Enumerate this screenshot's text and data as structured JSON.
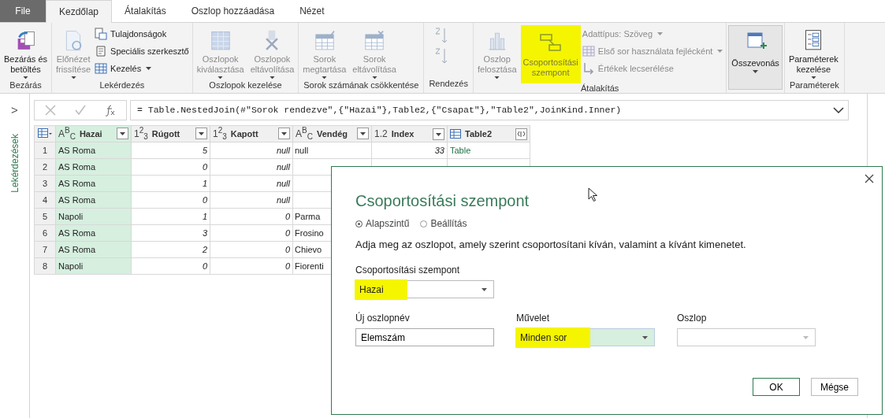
{
  "ribbon_tabs": [
    {
      "label": "File",
      "kind": "file",
      "selected": false
    },
    {
      "label": "Kezdőlap",
      "kind": "tab",
      "selected": true
    },
    {
      "label": "Átalakítás",
      "kind": "tab",
      "selected": false
    },
    {
      "label": "Oszlop hozzáadása",
      "kind": "tab",
      "selected": false
    },
    {
      "label": "Nézet",
      "kind": "tab",
      "selected": false
    }
  ],
  "ribbon_groups": [
    {
      "label": "Bezárás",
      "items": [
        {
          "kind": "large",
          "label": "Bezárás és\nbetöltés",
          "dropdown": true,
          "disabled": false
        }
      ]
    },
    {
      "label": "Lekérdezés",
      "items": [
        {
          "kind": "large",
          "label": "Előnézet\nfrissítése",
          "dropdown": true,
          "disabled": true
        },
        {
          "kind": "stack",
          "items": [
            {
              "label": "Tulajdonságok",
              "dropdown": false,
              "disabled": false
            },
            {
              "label": "Speciális szerkesztő",
              "dropdown": false,
              "disabled": false
            },
            {
              "label": "Kezelés",
              "dropdown": true,
              "disabled": false
            }
          ]
        }
      ]
    },
    {
      "label": "Oszlopok kezelése",
      "items": [
        {
          "kind": "large",
          "label": "Oszlopok\nkiválasztása",
          "dropdown": true,
          "disabled": true
        },
        {
          "kind": "large",
          "label": "Oszlopok\neltávolítása",
          "dropdown": true,
          "disabled": true
        }
      ]
    },
    {
      "label": "Sorok számának csökkentése",
      "items": [
        {
          "kind": "large",
          "label": "Sorok\nmegtartása",
          "dropdown": true,
          "disabled": true
        },
        {
          "kind": "large",
          "label": "Sorok\neltávolítása",
          "dropdown": true,
          "disabled": true
        }
      ]
    },
    {
      "label": "Rendezés",
      "items": [
        {
          "kind": "sort"
        }
      ]
    },
    {
      "label": "Átalakítás",
      "items": [
        {
          "kind": "large",
          "label": "Oszlop\nfelosztása",
          "dropdown": true,
          "disabled": true
        },
        {
          "kind": "large",
          "label": "Csoportosítási\nszempont",
          "dropdown": false,
          "disabled": true,
          "highlighted": true
        },
        {
          "kind": "stack",
          "items": [
            {
              "label": "Adattípus: Szöveg",
              "dropdown": true,
              "disabled": true
            },
            {
              "label": "Első sor használata fejlécként",
              "dropdown": true,
              "disabled": true
            },
            {
              "label": "Értékek lecserélése",
              "dropdown": false,
              "disabled": true
            }
          ]
        }
      ]
    },
    {
      "items": [
        {
          "kind": "large",
          "label": "Összevonás",
          "dropdown": true,
          "disabled": false,
          "pressed": true
        }
      ]
    },
    {
      "label": "Paraméterek",
      "items": [
        {
          "kind": "large",
          "label": "Paraméterek\nkezelése",
          "dropdown": true,
          "disabled": false
        }
      ]
    }
  ],
  "sidebar": {
    "title": "Lekérdezések",
    "expand": ">"
  },
  "formula_bar": {
    "formula": "= Table.NestedJoin(#\"Sorok rendezve\",{\"Hazai\"},Table2,{\"Csapat\"},\"Table2\",JoinKind.Inner)"
  },
  "table": {
    "columns": [
      {
        "type_label": "A$^{B}$$_{C}$",
        "name": "Hazai",
        "kind": "text",
        "selected": true
      },
      {
        "type_label": "1$^{2}$$_{3}$",
        "name": "Rúgott",
        "kind": "number",
        "selected": false
      },
      {
        "type_label": "1$^{2}$$_{3}$",
        "name": "Kapott",
        "kind": "number",
        "selected": false
      },
      {
        "type_label": "A$^{B}$$_{C}$",
        "name": "Vendég",
        "kind": "any",
        "selected": false
      },
      {
        "type_label": "1.2",
        "name": "Index",
        "kind": "number",
        "selected": false
      },
      {
        "name": "Table2",
        "kind": "table",
        "selected": false
      }
    ],
    "rows": [
      {
        "index": "1",
        "cells": [
          "AS Roma",
          "5",
          "null",
          "null",
          "33",
          "Table"
        ]
      },
      {
        "index": "2",
        "cells": [
          "AS Roma",
          "0",
          "null",
          "",
          "",
          ""
        ]
      },
      {
        "index": "3",
        "cells": [
          "AS Roma",
          "1",
          "null",
          "",
          "",
          ""
        ]
      },
      {
        "index": "4",
        "cells": [
          "AS Roma",
          "0",
          "null",
          "",
          "",
          ""
        ]
      },
      {
        "index": "5",
        "cells": [
          "Napoli",
          "1",
          "0",
          "Parma",
          "",
          ""
        ]
      },
      {
        "index": "6",
        "cells": [
          "AS Roma",
          "3",
          "0",
          "Frosino",
          "",
          ""
        ]
      },
      {
        "index": "7",
        "cells": [
          "AS Roma",
          "2",
          "0",
          "Chievo",
          "",
          ""
        ]
      },
      {
        "index": "8",
        "cells": [
          "Napoli",
          "0",
          "0",
          "Fiorenti",
          "",
          ""
        ]
      }
    ]
  },
  "dialog": {
    "title": "Csoportosítási szempont",
    "modes": [
      {
        "label": "Alapszintű",
        "selected": true
      },
      {
        "label": "Beállítás",
        "selected": false
      }
    ],
    "description": "Adja meg az oszlopot, amely szerint csoportosítani kíván, valamint a kívánt kimenetet.",
    "group_by": {
      "label": "Csoportosítási szempont",
      "value": "Hazai",
      "highlighted": true
    },
    "fields": [
      {
        "kind": "text",
        "label": "Új oszlopnév",
        "value": "Elemszám"
      },
      {
        "kind": "dropdown",
        "label": "Művelet",
        "value": "Minden sor",
        "highlighted": true,
        "selected": true,
        "disabled": false
      },
      {
        "kind": "dropdown",
        "label": "Oszlop",
        "disabled": true,
        "selected": false
      }
    ],
    "buttons": [
      {
        "label": "OK",
        "primary": true
      },
      {
        "label": "Mégse",
        "primary": false
      }
    ]
  }
}
